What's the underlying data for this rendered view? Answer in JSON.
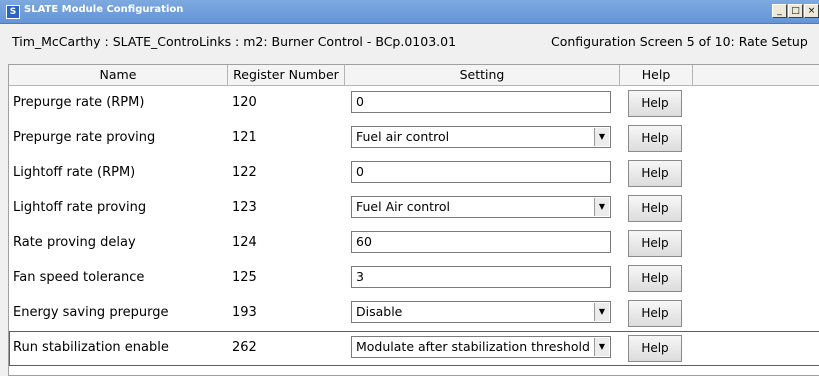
{
  "window": {
    "app_icon_letter": "S",
    "title": "SLATE Module Configuration",
    "minimize_glyph": "_",
    "maximize_glyph": "□",
    "close_glyph": "×"
  },
  "info": {
    "path": "Tim_McCarthy : SLATE_ControLinks : m2: Burner Control - BCp.0103.01",
    "screen": "Configuration Screen 5 of 10: Rate Setup"
  },
  "columns": {
    "name": "Name",
    "register": "Register Number",
    "setting": "Setting",
    "help": "Help"
  },
  "rows": [
    {
      "name": "Prepurge rate (RPM)",
      "register": "120",
      "type": "text",
      "value": "0",
      "help": "Help"
    },
    {
      "name": "Prepurge rate proving",
      "register": "121",
      "type": "select",
      "value": "Fuel air control",
      "help": "Help"
    },
    {
      "name": "Lightoff rate (RPM)",
      "register": "122",
      "type": "text",
      "value": "0",
      "help": "Help"
    },
    {
      "name": "Lightoff rate proving",
      "register": "123",
      "type": "select",
      "value": "Fuel Air control",
      "help": "Help"
    },
    {
      "name": "Rate proving delay",
      "register": "124",
      "type": "text",
      "value": "60",
      "help": "Help"
    },
    {
      "name": "Fan speed tolerance",
      "register": "125",
      "type": "text",
      "value": "3",
      "help": "Help"
    },
    {
      "name": "Energy saving prepurge",
      "register": "193",
      "type": "select",
      "value": "Disable",
      "help": "Help"
    },
    {
      "name": "Run stabilization enable",
      "register": "262",
      "type": "select",
      "value": "Modulate after stabilization threshold",
      "help": "Help",
      "selected": true
    }
  ],
  "colors": {
    "titlebar": "#6a9ad9",
    "selected_row_border": "#d42d2d"
  }
}
